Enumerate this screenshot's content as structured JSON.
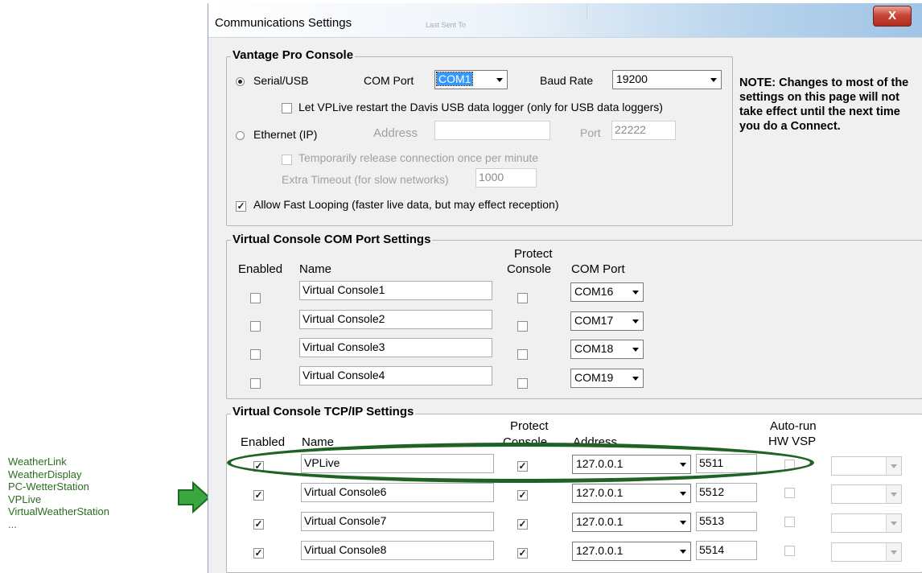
{
  "annotation": {
    "items": [
      "WeatherLink",
      "WeatherDisplay",
      "PC-WetterStation",
      "VPLive",
      "VirtualWeatherStation",
      "..."
    ]
  },
  "window": {
    "title": "Communications Settings",
    "ghost": "Last Sent To",
    "close_label": "X"
  },
  "vantage": {
    "title": "Vantage Pro Console",
    "serial_label": "Serial/USB",
    "com_port_label": "COM Port",
    "com_port_value": "COM1",
    "baud_label": "Baud Rate",
    "baud_value": "19200",
    "restart_label": "Let VPLive restart the Davis USB data logger (only for USB data loggers)",
    "ethernet_label": "Ethernet (IP)",
    "address_label": "Address",
    "address_value": "",
    "port_label": "Port",
    "port_value": "22222",
    "temp_release_label": "Temporarily release  connection once per minute",
    "extra_timeout_label": "Extra Timeout (for slow networks)",
    "extra_timeout_value": "1000",
    "fast_loop_label": "Allow Fast Looping (faster live data, but may effect reception)",
    "note": "NOTE: Changes to most of the settings on this page will not take effect until the next time you do a Connect."
  },
  "vc_com": {
    "title": "Virtual Console COM Port Settings",
    "headers": {
      "enabled": "Enabled",
      "name": "Name",
      "protect1": "Protect",
      "protect2": "Console",
      "com_port": "COM Port"
    },
    "rows": [
      {
        "name": "Virtual Console1",
        "port": "COM16"
      },
      {
        "name": "Virtual Console2",
        "port": "COM17"
      },
      {
        "name": "Virtual Console3",
        "port": "COM18"
      },
      {
        "name": "Virtual Console4",
        "port": "COM19"
      }
    ]
  },
  "vc_tcp": {
    "title": "Virtual Console TCP/IP Settings",
    "headers": {
      "enabled": "Enabled",
      "name": "Name",
      "protect1": "Protect",
      "protect2": "Console",
      "address": "Address",
      "autorun1": "Auto-run",
      "autorun2": "HW VSP"
    },
    "rows": [
      {
        "name": "VPLive",
        "address": "127.0.0.1",
        "port": "5511"
      },
      {
        "name": "Virtual Console6",
        "address": "127.0.0.1",
        "port": "5512"
      },
      {
        "name": "Virtual Console7",
        "address": "127.0.0.1",
        "port": "5513"
      },
      {
        "name": "Virtual Console8",
        "address": "127.0.0.1",
        "port": "5514"
      }
    ]
  }
}
